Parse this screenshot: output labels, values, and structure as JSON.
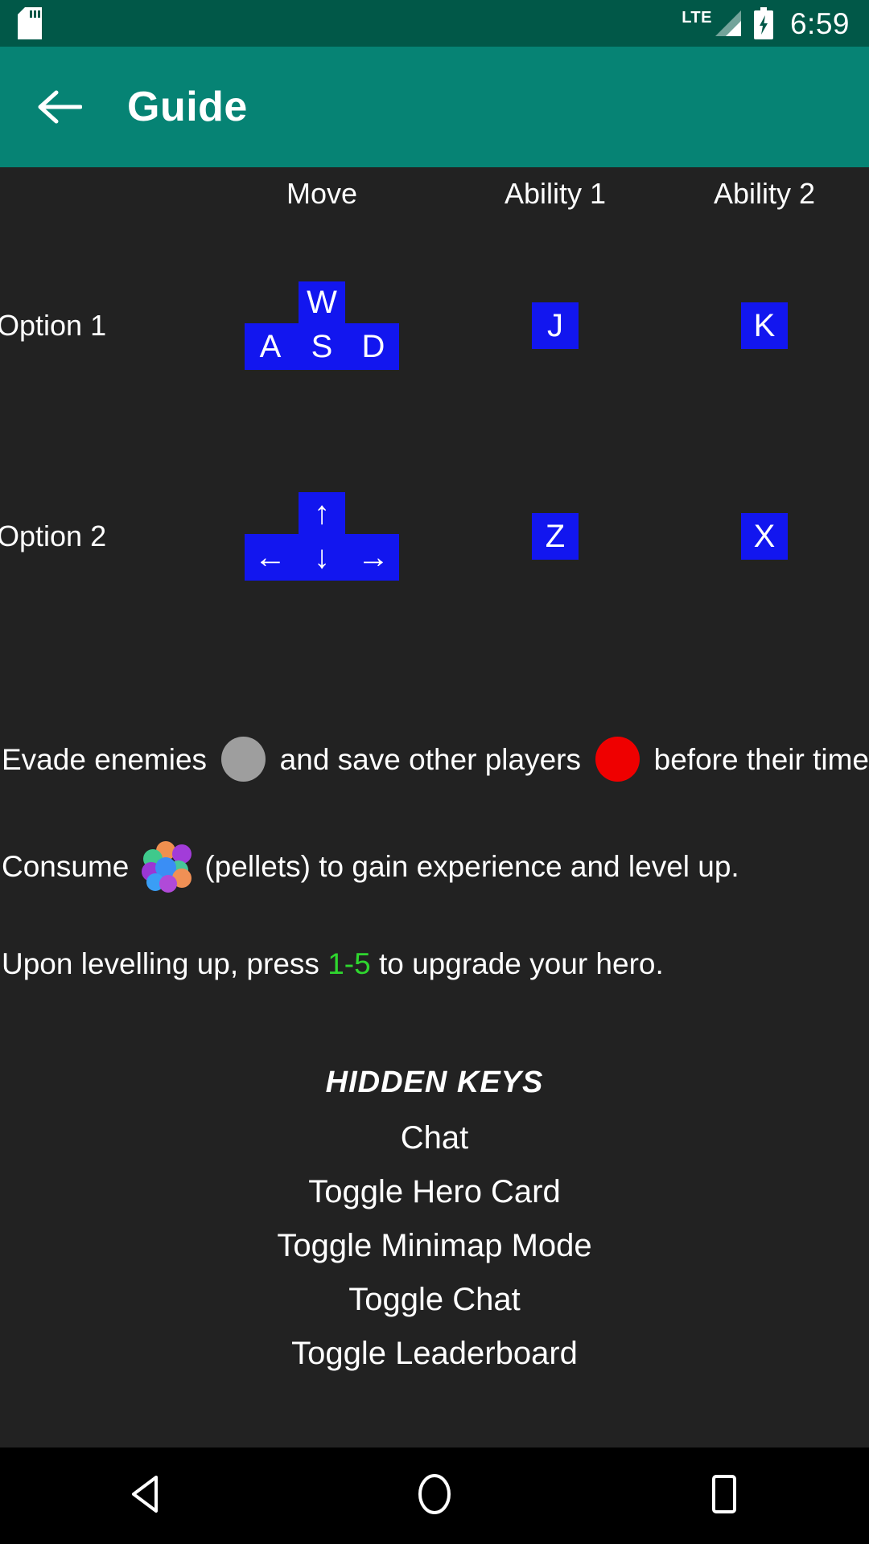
{
  "statusbar": {
    "sdcard_icon": "sdcard-icon",
    "network_label": "LTE",
    "signal_icon": "signal-bars-icon",
    "battery_icon": "battery-charging-icon",
    "time": "6:59",
    "background_color": "#015848"
  },
  "appbar": {
    "back_icon": "arrow-left-icon",
    "title": "Guide",
    "background_color": "#068374"
  },
  "table": {
    "headers": [
      "",
      "Move",
      "Ability 1",
      "Ability 2"
    ],
    "rows": [
      {
        "label": "Option 1",
        "move_cluster": {
          "top": "W",
          "bottom": [
            "A",
            "S",
            "D"
          ]
        },
        "ability1": "J",
        "ability2": "K"
      },
      {
        "label": "Option 2",
        "move_cluster": {
          "top": "↑",
          "bottom": [
            "←",
            "↓",
            "→"
          ]
        },
        "ability1": "Z",
        "ability2": "X"
      }
    ],
    "key_color": "#1216ef",
    "key_text_color": "#ffffff"
  },
  "instructions": {
    "line1": {
      "part1": "Evade enemies",
      "enemy_dot_color": "#9e9e9e",
      "part2": "and save other players",
      "player_dot_color": "#ef0000",
      "part3": "before their time"
    },
    "line2": {
      "part1": "Consume",
      "pellet_icon": "pellets-icon",
      "part2": "(pellets) to gain experience and level up."
    },
    "line3": {
      "part1": "Upon levelling up, press",
      "keys": "1-5",
      "keys_color": "#2fd62f",
      "part2": "to upgrade your hero."
    }
  },
  "hidden_keys": {
    "title": "HIDDEN KEYS",
    "items": [
      "Chat",
      "Toggle Hero Card",
      "Toggle Minimap Mode",
      "Toggle Chat",
      "Toggle Leaderboard"
    ]
  },
  "navbar": {
    "back_icon": "nav-back-triangle-icon",
    "home_icon": "nav-home-circle-icon",
    "recents_icon": "nav-recents-square-icon"
  }
}
